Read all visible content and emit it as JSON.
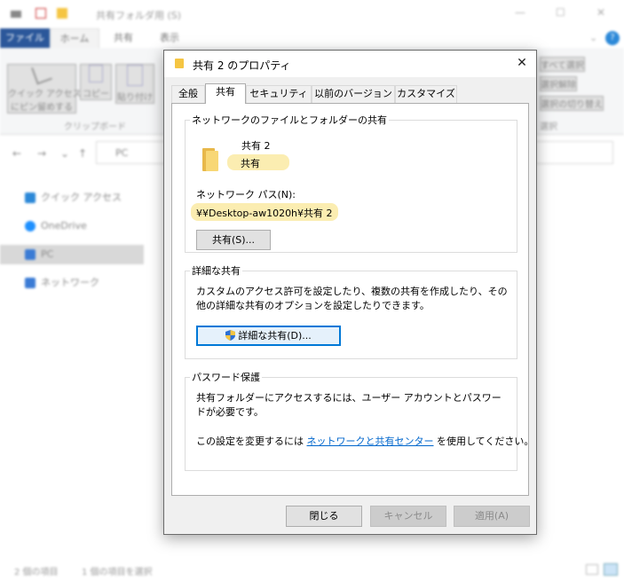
{
  "background_explorer": {
    "window_title": "共有フォルダ用 (S)",
    "ribbon_tabs": [
      "ファイル",
      "ホーム",
      "共有",
      "表示"
    ],
    "ribbon_buttons": [
      "クイック アクセス\nにピン留めする",
      "コピー",
      "貼り付け"
    ],
    "ribbon_group_label": "クリップボード",
    "ribbon_right_items": [
      "すべて選択",
      "選択解除",
      "選択の切り替え"
    ],
    "ribbon_right_group": "選択",
    "address_path": "PC",
    "nav_items": [
      {
        "label": "クイック アクセス",
        "color": "#2b88d8"
      },
      {
        "label": "OneDrive",
        "color": "#1e90ff"
      },
      {
        "label": "PC",
        "color": "#3a7bd5"
      },
      {
        "label": "ネットワーク",
        "color": "#3a7bd5"
      }
    ],
    "status_items_count": "2 個の項目",
    "status_selected": "1 個の項目を選択"
  },
  "dialog": {
    "title": "共有 2 のプロパティ",
    "tabs": [
      "全般",
      "共有",
      "セキュリティ",
      "以前のバージョン",
      "カスタマイズ"
    ],
    "active_tab": "共有",
    "network_sharing": {
      "legend": "ネットワークのファイルとフォルダーの共有",
      "folder_name": "共有 2",
      "share_state": "共有",
      "path_label": "ネットワーク パス(N):",
      "path_value": "¥¥Desktop-aw1020h¥共有 2",
      "share_button": "共有(S)..."
    },
    "advanced_sharing": {
      "legend": "詳細な共有",
      "description": "カスタムのアクセス許可を設定したり、複数の共有を作成したり、その他の詳細な共有のオプションを設定したりできます。",
      "button": "詳細な共有(D)..."
    },
    "password_protection": {
      "legend": "パスワード保護",
      "description": "共有フォルダーにアクセスするには、ユーザー アカウントとパスワードが必要です。",
      "change_prefix": "この設定を変更するには ",
      "change_link": "ネットワークと共有センター",
      "change_suffix": " を使用してください。"
    },
    "buttons": {
      "close": "閉じる",
      "cancel": "キャンセル",
      "apply": "適用(A)"
    }
  },
  "colors": {
    "accent": "#0078d7",
    "file_tab": "#2b579a",
    "highlight": "#fbedb1",
    "link": "#0066cc"
  }
}
